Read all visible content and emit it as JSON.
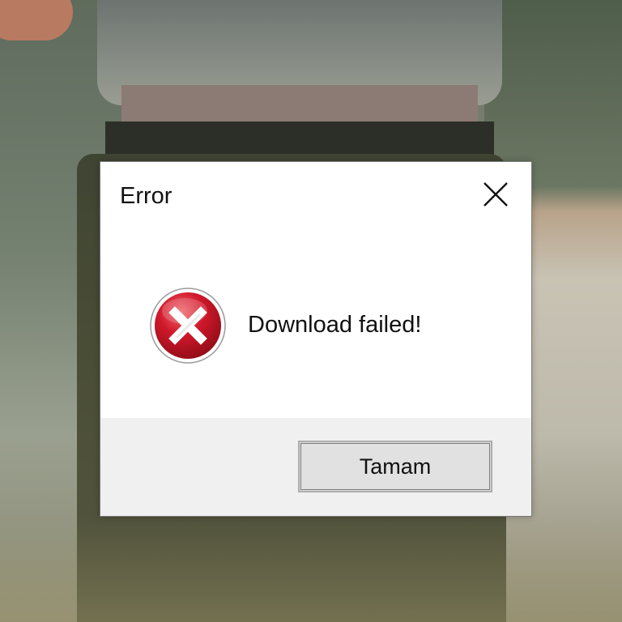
{
  "dialog": {
    "title": "Error",
    "message": "Download failed!",
    "ok_label": "Tamam",
    "icon": "error-icon"
  },
  "colors": {
    "error_red": "#c8102e",
    "dialog_bg": "#ffffff",
    "footer_bg": "#f0f0f0",
    "button_bg": "#e1e1e1"
  }
}
